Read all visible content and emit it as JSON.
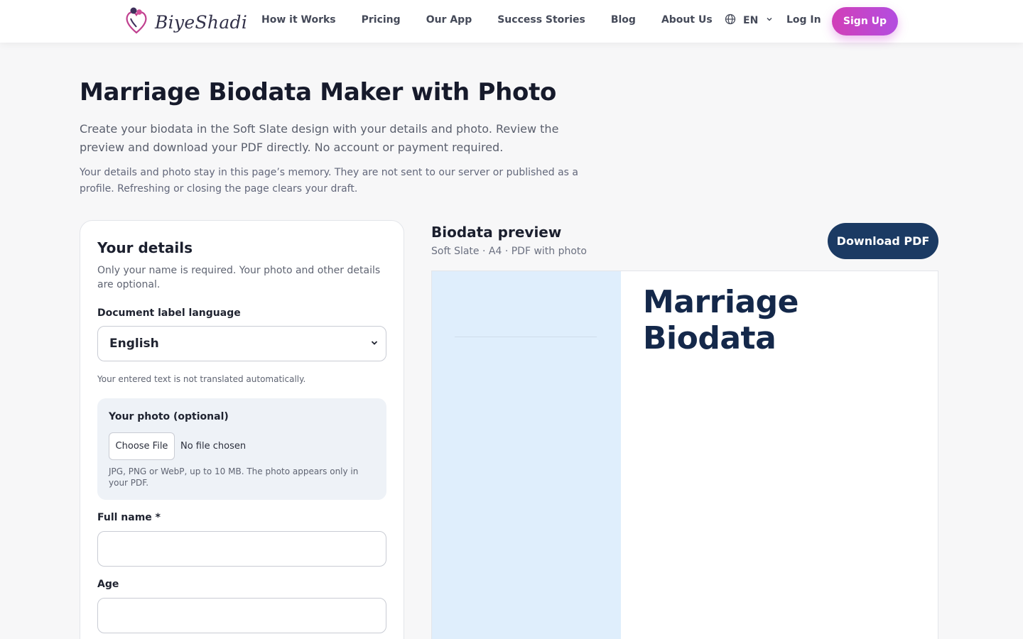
{
  "header": {
    "brand": "BiyeShadi",
    "nav": [
      "How it Works",
      "Pricing",
      "Our App",
      "Success Stories",
      "Blog",
      "About Us"
    ],
    "language": "EN",
    "login": "Log In",
    "signup": "Sign Up",
    "colors": {
      "signup_gradient_start": "#d13fb8",
      "signup_gradient_end": "#b34de0"
    }
  },
  "hero": {
    "title": "Marriage Biodata Maker with Photo",
    "intro": "Create your biodata in the Soft Slate design with your details and photo. Review the preview and download your PDF directly. No account or payment required.",
    "privacy": "Your details and photo stay in this page’s memory. They are not sent to our server or published as a profile. Refreshing or closing the page clears your draft."
  },
  "form": {
    "title": "Your details",
    "description": "Only your name is required. Your photo and other details are optional.",
    "language_label": "Document label language",
    "language_value": "English",
    "language_hint": "Your entered text is not translated automatically.",
    "photo": {
      "title": "Your photo (optional)",
      "button": "Choose File",
      "status": "No file chosen",
      "hint": "JPG, PNG or WebP, up to 10 MB. The photo appears only in your PDF."
    },
    "full_name_label": "Full name *",
    "full_name_value": "",
    "age_label": "Age",
    "age_value": ""
  },
  "preview": {
    "title": "Biodata preview",
    "subtitle": "Soft Slate · A4 · PDF with photo",
    "download": "Download PDF",
    "doc_title": "Marriage Biodata",
    "colors": {
      "download_bg": "#1b3a63",
      "doc_sidebar": "#dfeefc",
      "doc_title": "#14284a"
    }
  }
}
